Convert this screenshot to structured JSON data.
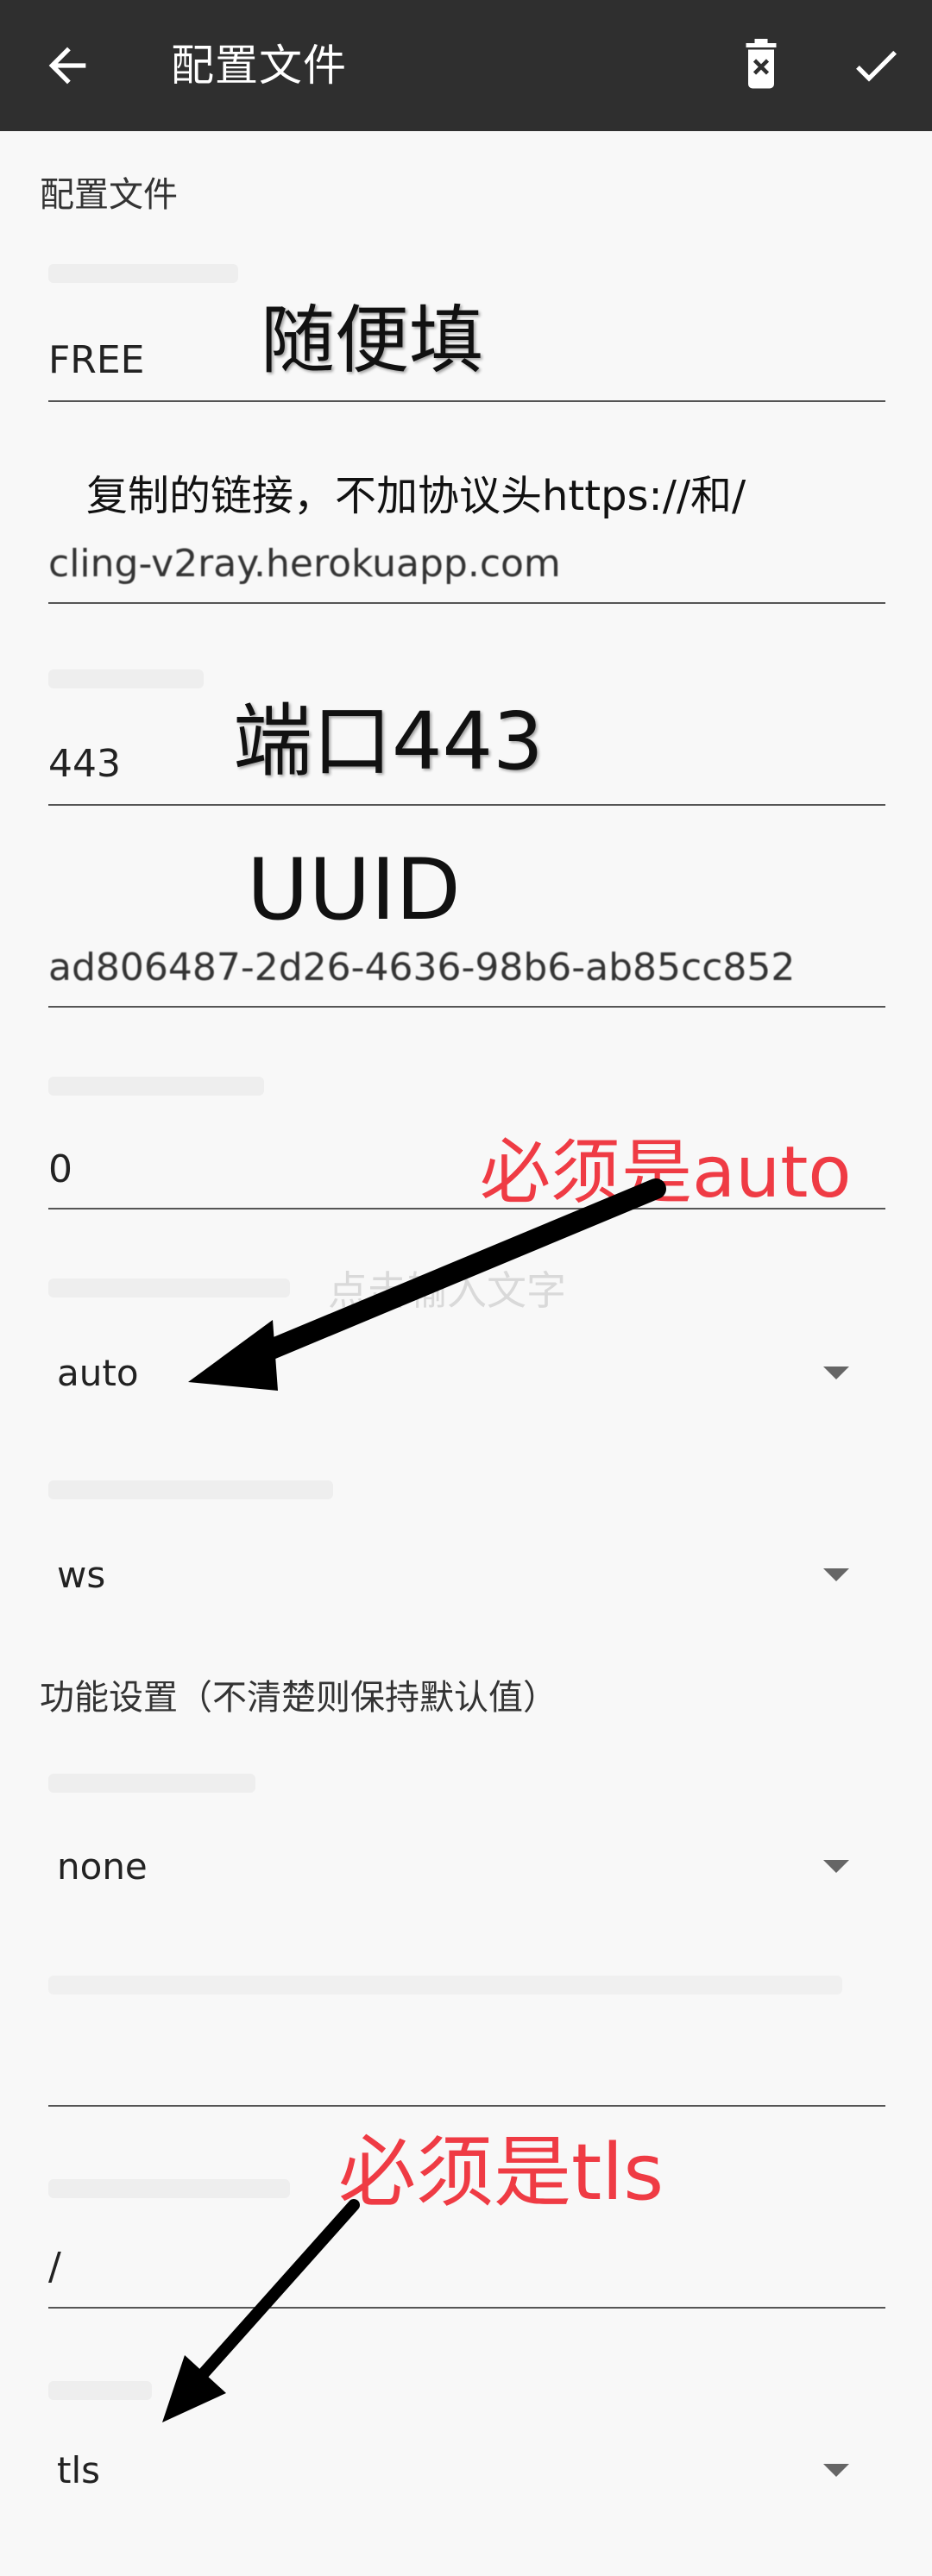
{
  "appbar": {
    "title": "配置文件",
    "back_icon": "arrow-back-icon",
    "delete_icon": "delete-icon",
    "confirm_icon": "check-icon",
    "background": "#2f2f2f"
  },
  "sections": {
    "profile": "配置文件",
    "features": "功能设置（不清楚则保持默认值）"
  },
  "fields": {
    "remarks": {
      "value": "FREE"
    },
    "address": {
      "value": "cling-v2ray.herokuapp.com"
    },
    "port": {
      "value": "443"
    },
    "uuid": {
      "value": "ad806487-2d26-4636-98b6-ab85cc852"
    },
    "alter_id": {
      "value": "0"
    },
    "security": {
      "selected": "auto"
    },
    "network": {
      "selected": "ws"
    },
    "header_type": {
      "selected": "none"
    },
    "path": {
      "value": "/"
    },
    "tls": {
      "selected": "tls"
    }
  },
  "annotations": {
    "remarks_note": "随便填",
    "address_note": "复制的链接，不加协议头https://和/",
    "port_note": "端口443",
    "uuid_note": "UUID",
    "security_note": "必须是auto",
    "tls_note": "必须是tls",
    "watermark": "点击输入文字",
    "red_color": "#ef3b44"
  }
}
